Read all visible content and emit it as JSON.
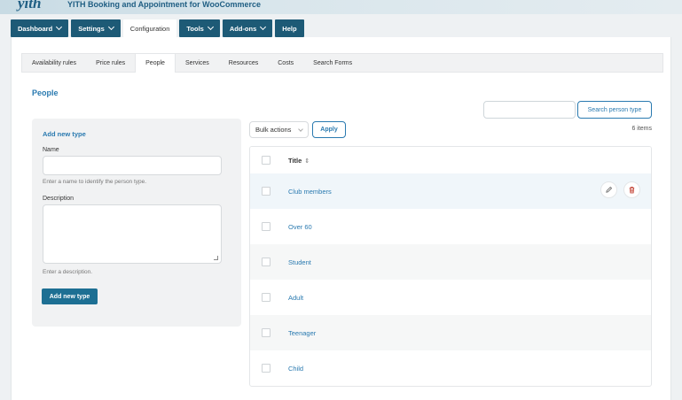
{
  "app": {
    "logo": "yith",
    "title": "YITH Booking and Appointment for WooCommerce"
  },
  "topnav": [
    {
      "label": "Dashboard",
      "dropdown": true,
      "active": false
    },
    {
      "label": "Settings",
      "dropdown": true,
      "active": false
    },
    {
      "label": "Configuration",
      "dropdown": false,
      "active": true
    },
    {
      "label": "Tools",
      "dropdown": true,
      "active": false
    },
    {
      "label": "Add-ons",
      "dropdown": true,
      "active": false
    },
    {
      "label": "Help",
      "dropdown": false,
      "active": false
    }
  ],
  "subtabs": [
    {
      "label": "Availability rules",
      "active": false
    },
    {
      "label": "Price rules",
      "active": false
    },
    {
      "label": "People",
      "active": true
    },
    {
      "label": "Services",
      "active": false
    },
    {
      "label": "Resources",
      "active": false
    },
    {
      "label": "Costs",
      "active": false
    },
    {
      "label": "Search Forms",
      "active": false
    }
  ],
  "page": {
    "title": "People"
  },
  "add_form": {
    "title": "Add new type",
    "name_label": "Name",
    "name_value": "",
    "name_hint": "Enter a name to identify the person type.",
    "description_label": "Description",
    "description_value": "",
    "description_hint": "Enter a description.",
    "submit_label": "Add new type"
  },
  "search": {
    "value": "",
    "button_label": "Search person type"
  },
  "bulk": {
    "selected": "Bulk actions",
    "apply_label": "Apply"
  },
  "items_count": "6 items",
  "table": {
    "column_title": "Title",
    "rows": [
      {
        "title": "Club members"
      },
      {
        "title": "Over 60"
      },
      {
        "title": "Student"
      },
      {
        "title": "Adult"
      },
      {
        "title": "Teenager"
      },
      {
        "title": "Child"
      }
    ]
  },
  "colors": {
    "nav": "#1d5a76",
    "link": "#2a7ab0",
    "primary_button": "#1d6f93",
    "delete": "#c0392b"
  }
}
